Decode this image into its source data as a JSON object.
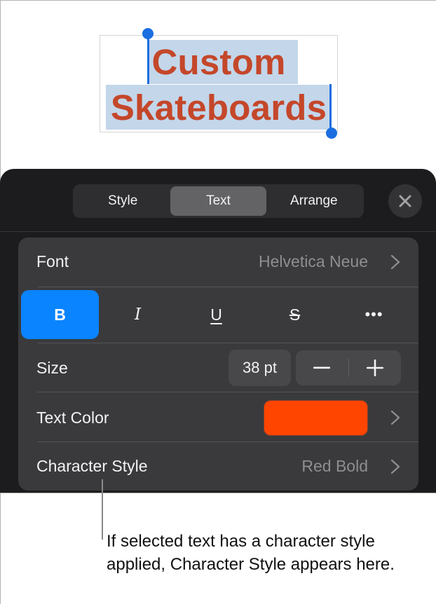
{
  "canvas": {
    "text_box": {
      "line1": "Custom",
      "line2": "Skateboards",
      "text_color": "#c4472a",
      "selection_color": "#c3d6ea",
      "caret_color": "#1b6ee0"
    }
  },
  "popover": {
    "tabs": [
      {
        "label": "Style",
        "active": false
      },
      {
        "label": "Text",
        "active": true
      },
      {
        "label": "Arrange",
        "active": false
      }
    ],
    "close_icon": "close-icon",
    "font": {
      "label": "Font",
      "value": "Helvetica Neue"
    },
    "format_buttons": [
      {
        "name": "bold",
        "glyph": "B",
        "active": true
      },
      {
        "name": "italic",
        "glyph": "I",
        "active": false
      },
      {
        "name": "underline",
        "glyph": "U",
        "active": false
      },
      {
        "name": "strikethrough",
        "glyph": "S",
        "active": false
      },
      {
        "name": "more",
        "glyph": "•••",
        "active": false
      }
    ],
    "size": {
      "label": "Size",
      "value": "38 pt",
      "decrement": "−",
      "increment": "+"
    },
    "text_color": {
      "label": "Text Color",
      "swatch": "#ff4500"
    },
    "character_style": {
      "label": "Character Style",
      "value": "Red Bold"
    },
    "accent_color": "#0a84ff"
  },
  "callout": {
    "text": "If selected text has a character style applied, Character Style appears here."
  }
}
